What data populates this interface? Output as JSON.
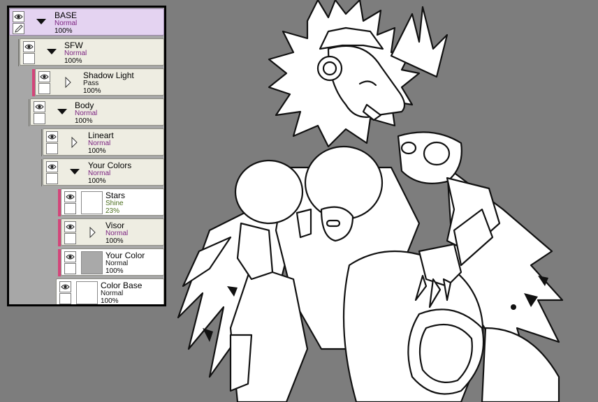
{
  "colors": {
    "background": "#7d7d7d",
    "panel_bg": "#a7a7a7",
    "layer_bg": "#eeede2",
    "selected_bg": "#e4d3f1",
    "clip_bar": "#d4457a",
    "mode_purple": "#7b2280",
    "mode_green": "#4b6e1e"
  },
  "canvas": {
    "content": "line-art"
  },
  "layers": [
    {
      "name": "BASE",
      "mode": "Normal",
      "opacity": "100%",
      "type": "folder",
      "expanded": true,
      "selected": true
    },
    {
      "name": "SFW",
      "mode": "Normal",
      "opacity": "100%",
      "type": "folder",
      "expanded": true
    },
    {
      "name": "Shadow Light",
      "mode": "Pass",
      "opacity": "100%",
      "type": "folder",
      "expanded": false,
      "clipped": true
    },
    {
      "name": "Body",
      "mode": "Normal",
      "opacity": "100%",
      "type": "folder",
      "expanded": true
    },
    {
      "name": "Lineart",
      "mode": "Normal",
      "opacity": "100%",
      "type": "folder",
      "expanded": false
    },
    {
      "name": "Your Colors",
      "mode": "Normal",
      "opacity": "100%",
      "type": "folder",
      "expanded": true
    },
    {
      "name": "Stars",
      "mode": "Shine",
      "opacity": "23%",
      "type": "layer",
      "clipped": true
    },
    {
      "name": "Visor",
      "mode": "Normal",
      "opacity": "100%",
      "type": "folder",
      "expanded": false,
      "clipped": true
    },
    {
      "name": "Your Color",
      "mode": "Normal",
      "opacity": "100%",
      "type": "layer",
      "clipped": true
    },
    {
      "name": "Color Base",
      "mode": "Normal",
      "opacity": "100%",
      "type": "layer"
    }
  ]
}
